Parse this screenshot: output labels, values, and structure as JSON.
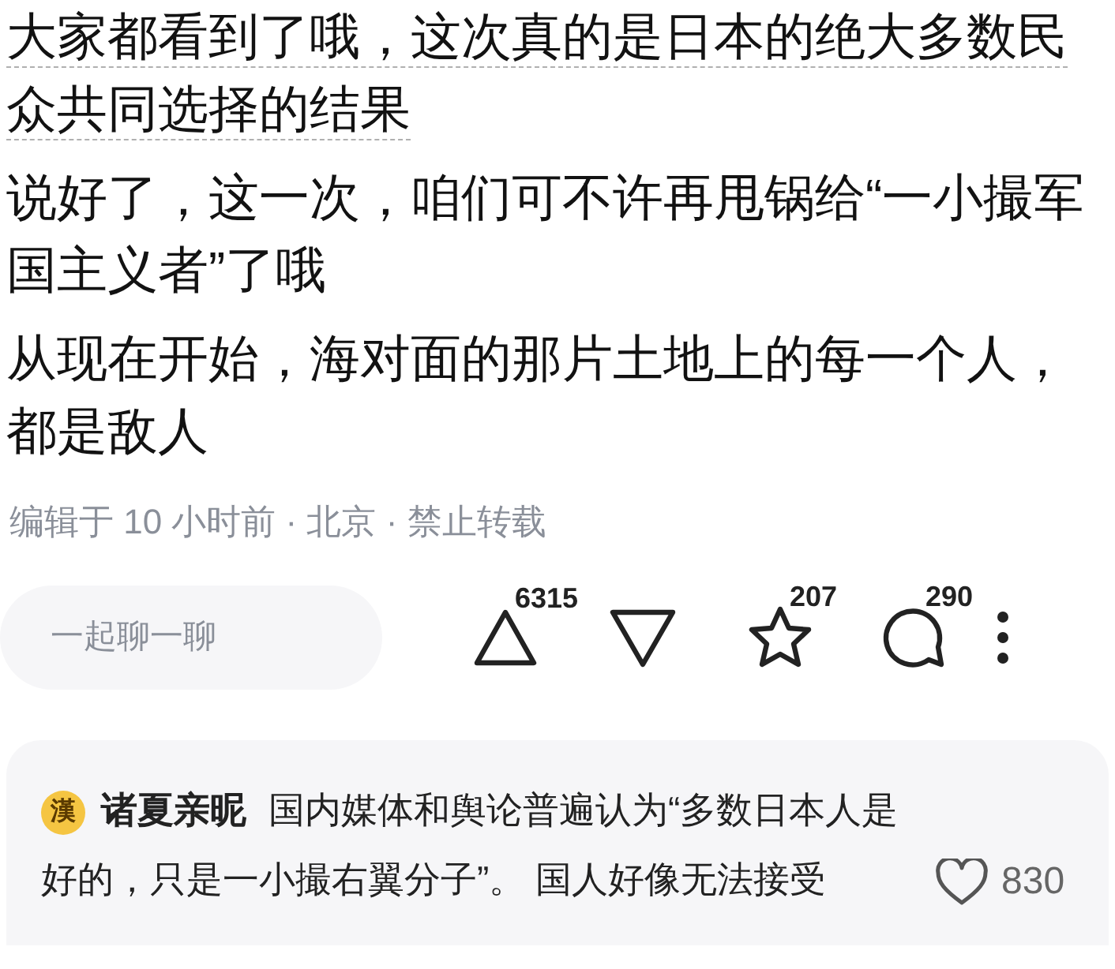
{
  "paragraphs": [
    {
      "text": "大家都看到了哦，这次真的是日本的绝大多数民众共同选择的结果",
      "underlined": true
    },
    {
      "text": "说好了，这一次，咱们可不许再甩锅给“一小撮军国主义者”了哦",
      "underlined": false
    },
    {
      "text": "从现在开始，海对面的那片土地上的每一个人，都是敌人",
      "underlined": false
    }
  ],
  "meta": "编辑于 10 小时前 · 北京 · 禁止转载",
  "chat_button": "一起聊一聊",
  "actions": [
    {
      "kind": "upvote",
      "count": "6315"
    },
    {
      "kind": "downvote"
    },
    {
      "kind": "favorite",
      "count": "207"
    },
    {
      "kind": "comment",
      "count": "290"
    },
    {
      "kind": "more"
    }
  ],
  "comment": {
    "avatar_text": "漢",
    "author": "诸夏亲昵",
    "text": "国内媒体和舆论普遍认为“多数日本人是好的，只是一小撮右翼分子”。 国人好像无法接受",
    "likes": "830"
  }
}
